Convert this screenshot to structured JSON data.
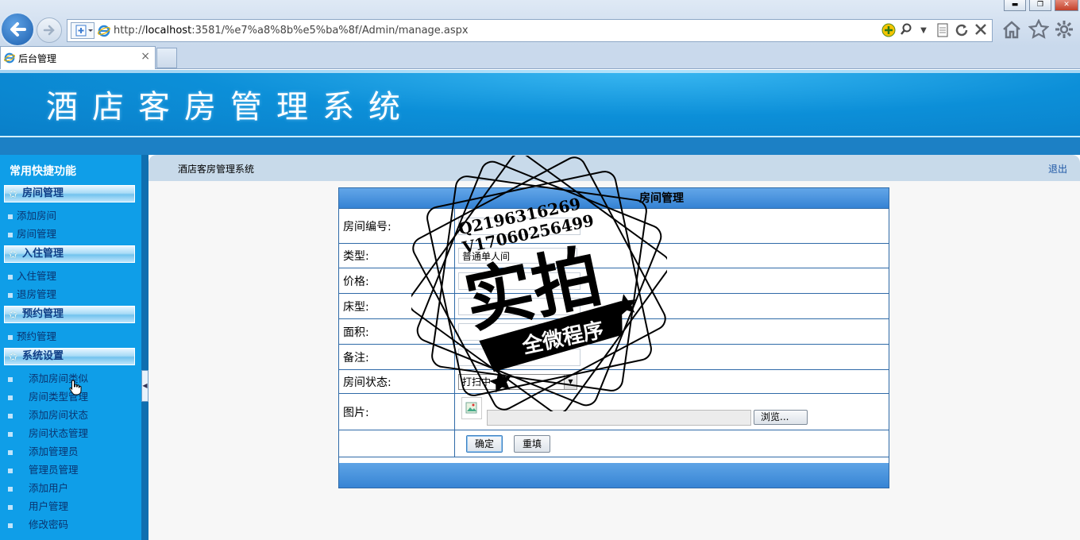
{
  "browser": {
    "url_prefix": "http://",
    "url_host": "localhost",
    "url_rest": ":3581/%e7%a8%8b%e5%ba%8f/Admin/manage.aspx",
    "tab_title": "后台管理",
    "tab_close": "×",
    "win_min": "▬",
    "win_max": "❐",
    "win_close": "✕",
    "icons": [
      "back-arrow-icon",
      "forward-arrow-icon",
      "site-favicon-icon",
      "ie-icon",
      "add-icon",
      "search-icon",
      "dropdown-icon",
      "compat-view-icon",
      "refresh-icon",
      "stop-icon",
      "home-icon",
      "favorites-star-icon",
      "settings-gear-icon"
    ]
  },
  "banner": {
    "title": "酒店客房管理系统"
  },
  "sidebar": {
    "title": "常用快捷功能",
    "groups": [
      {
        "label": "房间管理",
        "items": [
          "添加房间",
          "房间管理"
        ]
      },
      {
        "label": "入住管理",
        "items": [
          "入住管理",
          "退房管理"
        ]
      },
      {
        "label": "预约管理",
        "items": [
          "预约管理"
        ]
      },
      {
        "label": "系统设置",
        "items": [
          "添加房间类似",
          "房间类型管理",
          "添加房间状态",
          "房间状态管理",
          "添加管理员",
          "管理员管理",
          "添加用户",
          "用户管理",
          "修改密码"
        ]
      }
    ]
  },
  "header": {
    "title": "酒店客房管理系统",
    "logout": "退出"
  },
  "form": {
    "caption": "房间管理",
    "fields": {
      "room_no_label": "房间编号:",
      "type_label": "类型:",
      "type_value": "普通单人间",
      "price_label": "价格:",
      "bed_label": "床型:",
      "area_label": "面积:",
      "remark_label": "备注:",
      "status_label": "房间状态:",
      "status_value": "打扫中",
      "image_label": "图片:",
      "browse": "浏览..."
    },
    "buttons": {
      "confirm": "确定",
      "reset": "重填"
    }
  },
  "stamp": {
    "line1": "Q2196316269",
    "line2": "V17060256499",
    "big": "实拍",
    "ribbon": "全微程序"
  },
  "colors": {
    "banner": "#0c8fd8",
    "sidebar": "#0f9ee8",
    "form_header": "#3583d4",
    "border": "#2f6aa8"
  }
}
